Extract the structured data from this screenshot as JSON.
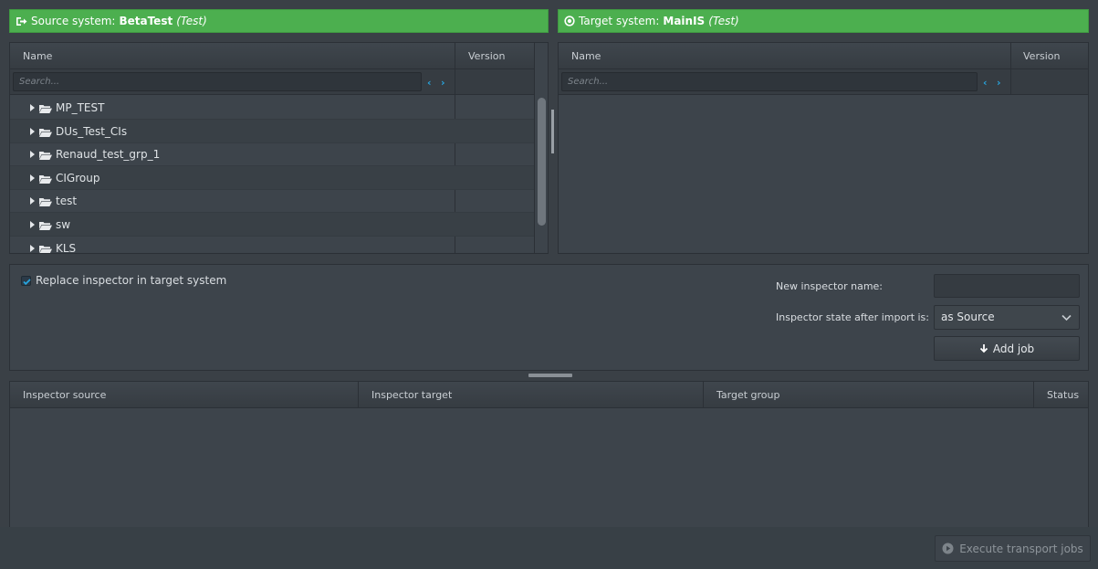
{
  "source_bar": {
    "label": "Source system:",
    "system": "BetaTest",
    "env": "(Test)",
    "icon": "sign-out-icon"
  },
  "target_bar": {
    "label": "Target system:",
    "system": "MainIS",
    "env": "(Test)",
    "icon": "dot-circle-icon"
  },
  "source_tree": {
    "col_name": "Name",
    "col_version": "Version",
    "search_placeholder": "Search...",
    "items": [
      {
        "label": "MP_TEST"
      },
      {
        "label": "DUs_Test_CIs"
      },
      {
        "label": "Renaud_test_grp_1"
      },
      {
        "label": "CIGroup"
      },
      {
        "label": "test"
      },
      {
        "label": "sw"
      },
      {
        "label": "KLS"
      }
    ]
  },
  "target_tree": {
    "col_name": "Name",
    "col_version": "Version",
    "search_placeholder": "Search..."
  },
  "options": {
    "replace_label": "Replace inspector in target system",
    "replace_checked": true,
    "new_name_label": "New inspector name:",
    "new_name_value": "",
    "state_label": "Inspector state after import is:",
    "state_value": "as Source",
    "add_job_label": "Add job"
  },
  "jobs_table": {
    "columns": [
      "Inspector source",
      "Inspector target",
      "Target group",
      "Status"
    ],
    "rows": []
  },
  "footer": {
    "execute_label": "Execute transport jobs"
  },
  "colors": {
    "accent_green": "#4caf4f",
    "link_blue": "#27a4dd",
    "background": "#3a4046"
  }
}
